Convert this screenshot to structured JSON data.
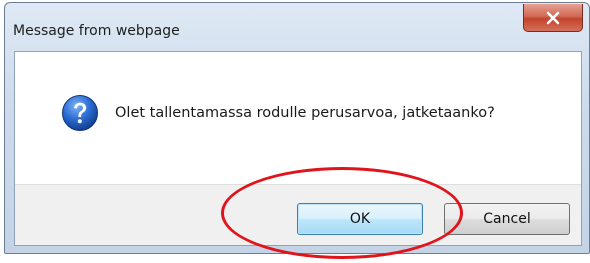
{
  "dialog": {
    "title": "Message from webpage",
    "message": "Olet tallentamassa rodulle perusarvoa, jatketaanko?",
    "icon": "question-icon",
    "close_icon": "close-icon"
  },
  "buttons": {
    "ok_label": "OK",
    "cancel_label": "Cancel"
  },
  "colors": {
    "question_icon": "#1f5fc4",
    "highlight_ring": "#e0141b",
    "close_button": "#c3432b"
  }
}
